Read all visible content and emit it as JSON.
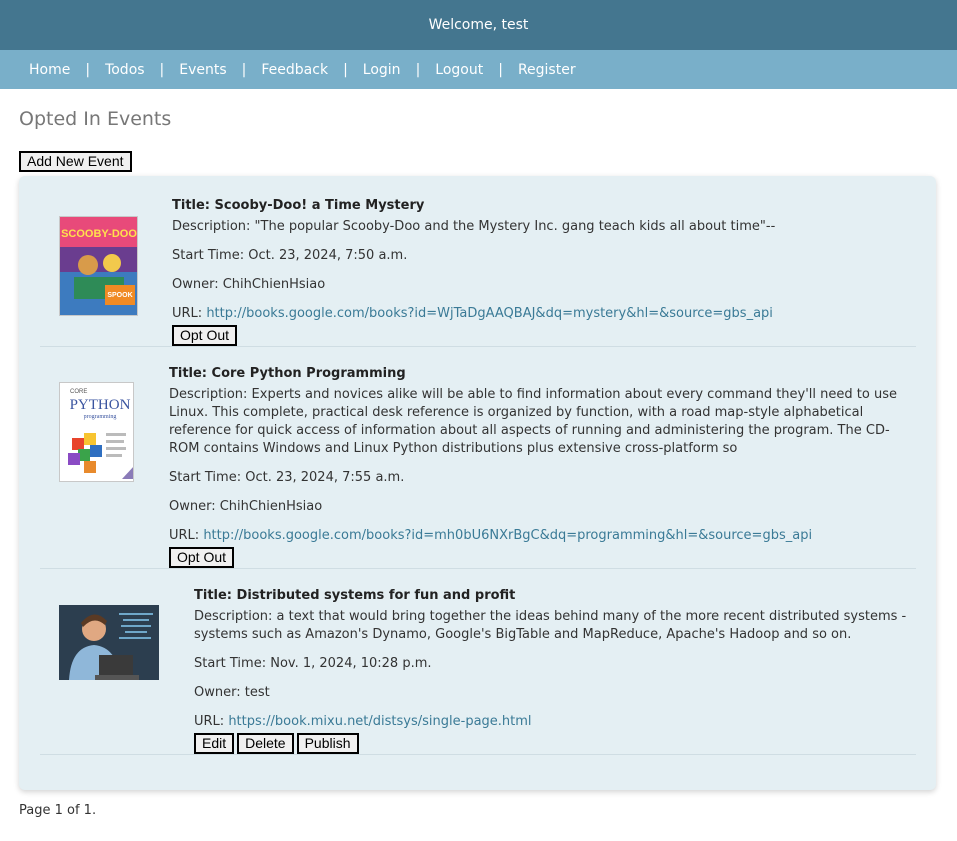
{
  "header": {
    "welcome": "Welcome, test"
  },
  "nav": {
    "home": "Home",
    "todos": "Todos",
    "events": "Events",
    "feedback": "Feedback",
    "login": "Login",
    "logout": "Logout",
    "register": "Register",
    "separator": "|"
  },
  "page": {
    "title": "Opted In Events",
    "add_button": "Add New Event",
    "pagination": "Page 1 of 1."
  },
  "events": [
    {
      "title": "Title: Scooby-Doo! a Time Mystery",
      "description": "Description: \"The popular Scooby-Doo and the Mystery Inc. gang teach kids all about time\"--",
      "start_time": "Start Time: Oct. 23, 2024, 7:50 a.m.",
      "owner": "Owner: ChihChienHsiao",
      "url_label": "URL: ",
      "url": "http://books.google.com/books?id=WjTaDgAAQBAJ&dq=mystery&hl=&source=gbs_api",
      "opt_out": "Opt Out",
      "thumb_text": "SCOOBY-DOO",
      "thumb_sub": "SPOOK"
    },
    {
      "title": "Title: Core Python Programming",
      "description": "Description: Experts and novices alike will be able to find information about every command they'll need to use Linux. This complete, practical desk reference is organized by function, with a road map-style alphabetical reference for quick access of information about all aspects of running and administering the program. The CD-ROM contains Windows and Linux Python distributions plus extensive cross-platform so",
      "start_time": "Start Time: Oct. 23, 2024, 7:55 a.m.",
      "owner": "Owner: ChihChienHsiao",
      "url_label": "URL: ",
      "url": "http://books.google.com/books?id=mh0bU6NXrBgC&dq=programming&hl=&source=gbs_api",
      "opt_out": "Opt Out",
      "thumb_top": "CORE",
      "thumb_main": "PYTHON",
      "thumb_sub": "programming"
    },
    {
      "title": "Title: Distributed systems for fun and profit",
      "description": "Description: a text that would bring together the ideas behind many of the more recent distributed systems - systems such as Amazon's Dynamo, Google's BigTable and MapReduce, Apache's Hadoop and so on.",
      "start_time": "Start Time: Nov. 1, 2024, 10:28 p.m.",
      "owner": "Owner: test",
      "url_label": "URL: ",
      "url": "https://book.mixu.net/distsys/single-page.html",
      "edit": "Edit",
      "delete": "Delete",
      "publish": "Publish"
    }
  ],
  "colors": {
    "topbar": "#44768f",
    "navbar": "#79afc9",
    "panel": "#e4eff3",
    "link": "#3a7a96"
  }
}
